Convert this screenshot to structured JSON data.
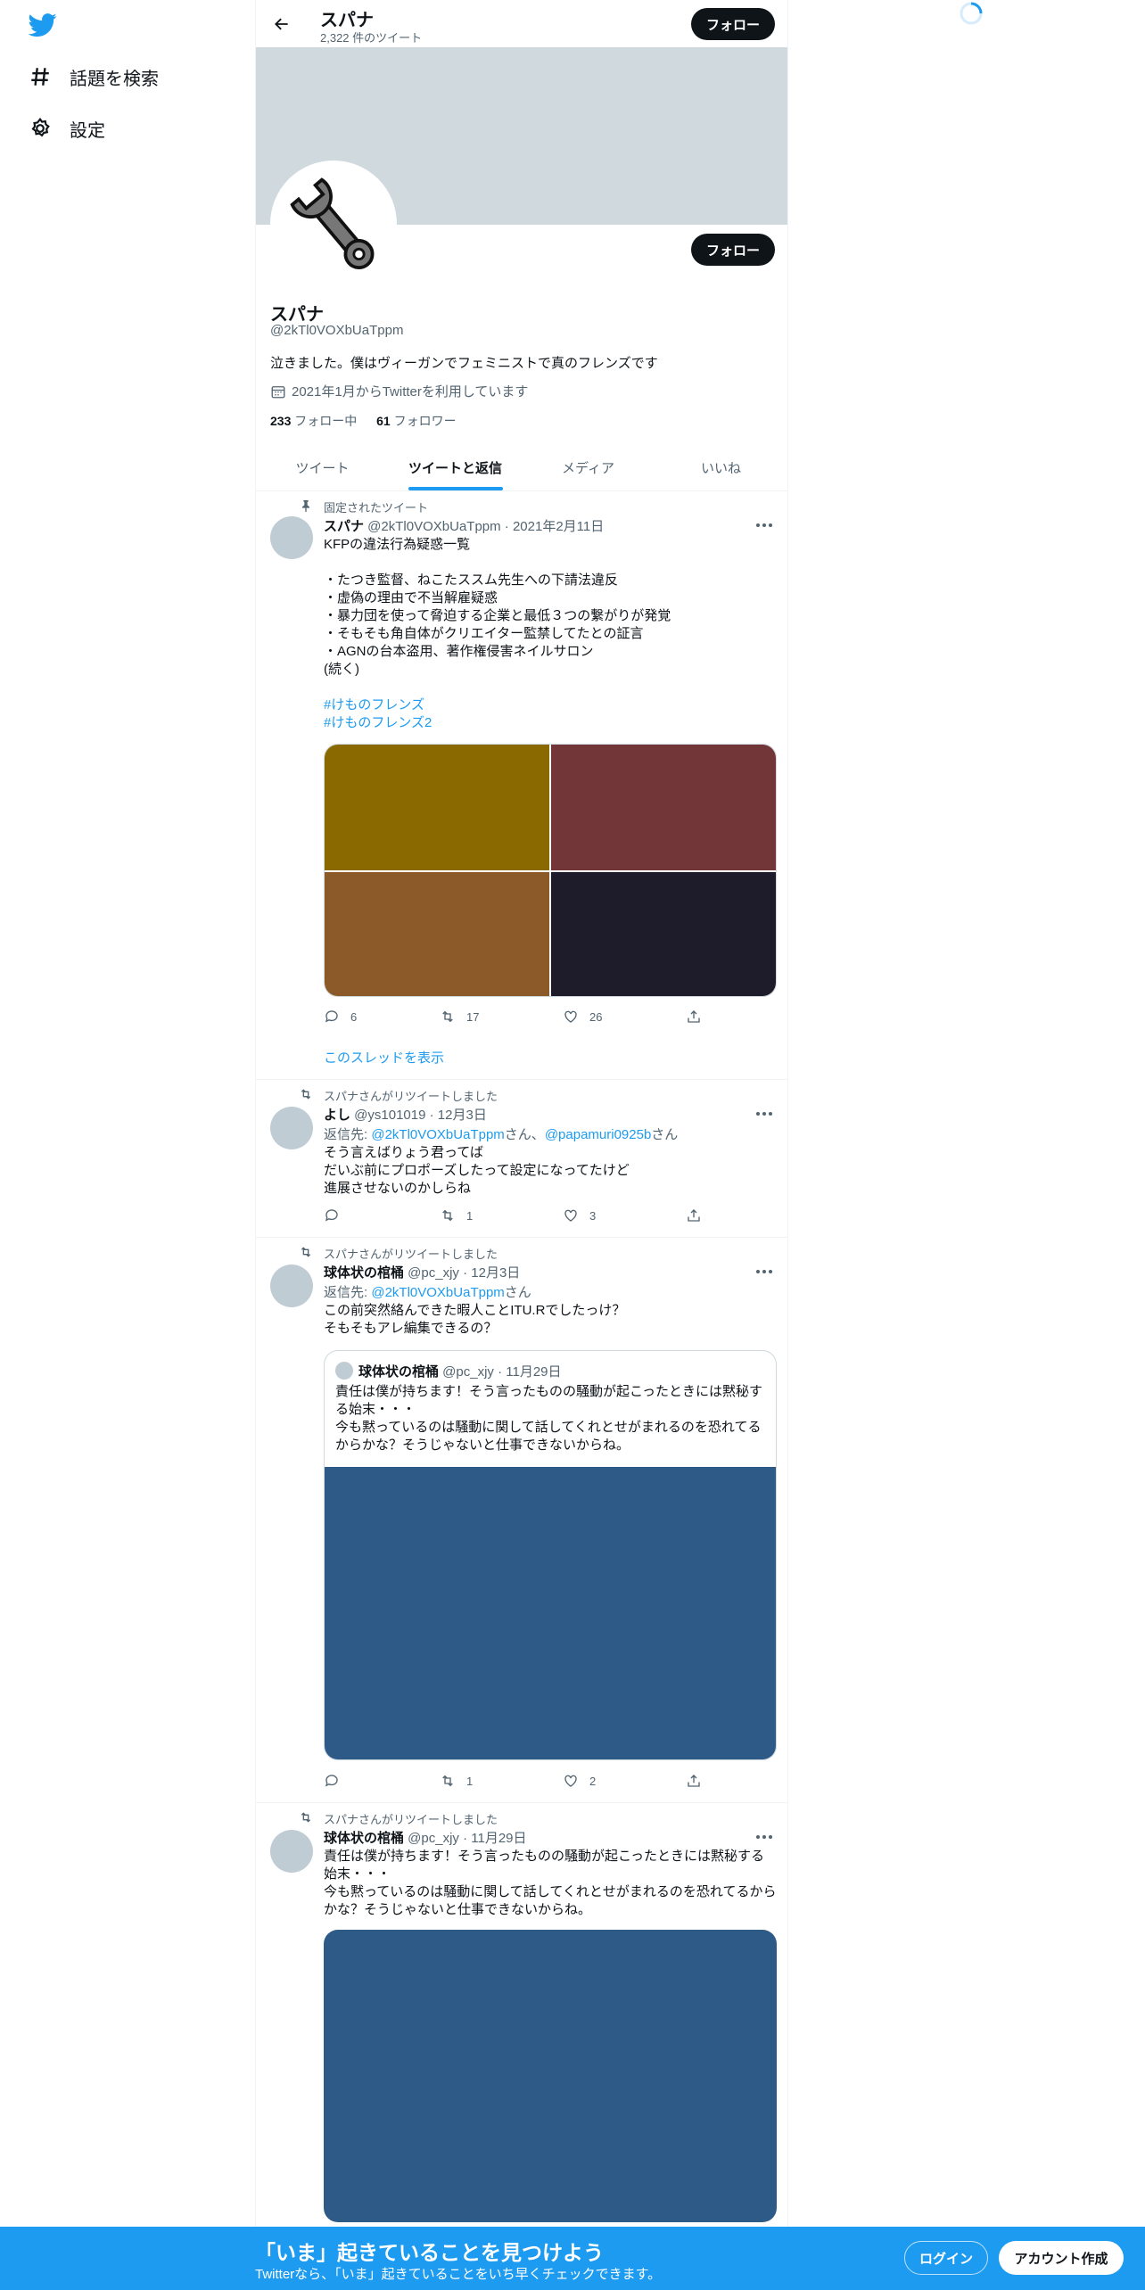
{
  "sidebar": {
    "logo": "twitter-bird-icon",
    "items": [
      {
        "label": "話題を検索",
        "icon": "hashtag-icon"
      },
      {
        "label": "設定",
        "icon": "gear-icon"
      }
    ]
  },
  "header": {
    "name": "スパナ",
    "tweet_count": "2,322 件のツイート",
    "follow_label": "フォロー"
  },
  "profile": {
    "name": "スパナ",
    "handle": "@2kTl0VOXbUaTppm",
    "bio": "泣きました。僕はヴィーガンでフェミニストで真のフレンズです",
    "joined": "2021年1月からTwitterを利用しています",
    "following_count": "233",
    "following_label": " フォロー中",
    "followers_count": "61",
    "followers_label": " フォロワー",
    "follow_label": "フォロー"
  },
  "tabs": [
    {
      "label": "ツイート",
      "active": false
    },
    {
      "label": "ツイートと返信",
      "active": true
    },
    {
      "label": "メディア",
      "active": false
    },
    {
      "label": "いいね",
      "active": false
    }
  ],
  "tweets": [
    {
      "context": "固定されたツイート",
      "name": "スパナ",
      "meta": " @2kTl0VOXbUaTppm · 2021年2月11日",
      "text": "KFPの違法行為疑惑一覧\n\n・たつき監督、ねこたススム先生への下請法違反\n・虚偽の理由で不当解雇疑惑\n・暴力団を使って脅迫する企業と最低３つの繋がりが発覚\n・そもそも角自体がクリエイター監禁してたとの証言\n・AGNの台本盗用、著作権侵害ネイルサロン\n(続く)",
      "hashtags": [
        "#けものフレンズ",
        "#けものフレンズ2"
      ],
      "media_colors": [
        "#8a6a00",
        "#723538",
        "#8c5a28",
        "#1e1c2a"
      ],
      "replies": "6",
      "retweets": "17",
      "likes": "26",
      "thread_link": "このスレッドを表示"
    },
    {
      "context": "スパナさんがリツイートしました",
      "name": "よし",
      "meta": " @ys101019 · 12月3日",
      "reply_prefix": "返信先: ",
      "reply_user1": "@2kTl0VOXbUaTppm",
      "reply_mid": "さん、",
      "reply_user2": "@papamuri0925b",
      "reply_suffix": "さん",
      "text": "そう言えばりょう君ってば\nだいぶ前にプロポーズしたって設定になってたけど\n進展させないのかしらね",
      "replies": "",
      "retweets": "1",
      "likes": "3"
    },
    {
      "context": "スパナさんがリツイートしました",
      "name": "球体状の棺桶",
      "meta": " @pc_xjy · 12月3日",
      "reply_prefix": "返信先: ",
      "reply_user1": "@2kTl0VOXbUaTppm",
      "reply_suffix": "さん",
      "text": "この前突然絡んできた暇人ことITU.Rでしたっけ？\nそもそもアレ編集できるの？",
      "quote": {
        "name": "球体状の棺桶",
        "meta": " @pc_xjy · 11月29日",
        "text": "責任は僕が持ちます！そう言ったものの騒動が起こったときには黙秘する始末・・・\n今も黙っているのは騒動に関して話してくれとせがまれるのを恐れてるからかな？そうじゃないと仕事できないからね。"
      },
      "replies": "",
      "retweets": "1",
      "likes": "2"
    },
    {
      "context": "スパナさんがリツイートしました",
      "name": "球体状の棺桶",
      "meta": " @pc_xjy · 11月29日",
      "text": "責任は僕が持ちます！そう言ったものの騒動が起こったときには黙秘する始末・・・\n今も黙っているのは騒動に関して話してくれとせがまれるのを恐れてるからかな？そうじゃないと仕事できないからね。"
    }
  ],
  "bottom_bar": {
    "title": "「いま」起きていることを見つけよう",
    "subtitle": "Twitterなら、「いま」起きていることをいち早くチェックできます。",
    "login_label": "ログイン",
    "signup_label": "アカウント作成"
  },
  "colors": {
    "accent": "#1d9bf0",
    "banner": "#cfd9de",
    "text": "#0f1419",
    "secondary": "#536471"
  }
}
